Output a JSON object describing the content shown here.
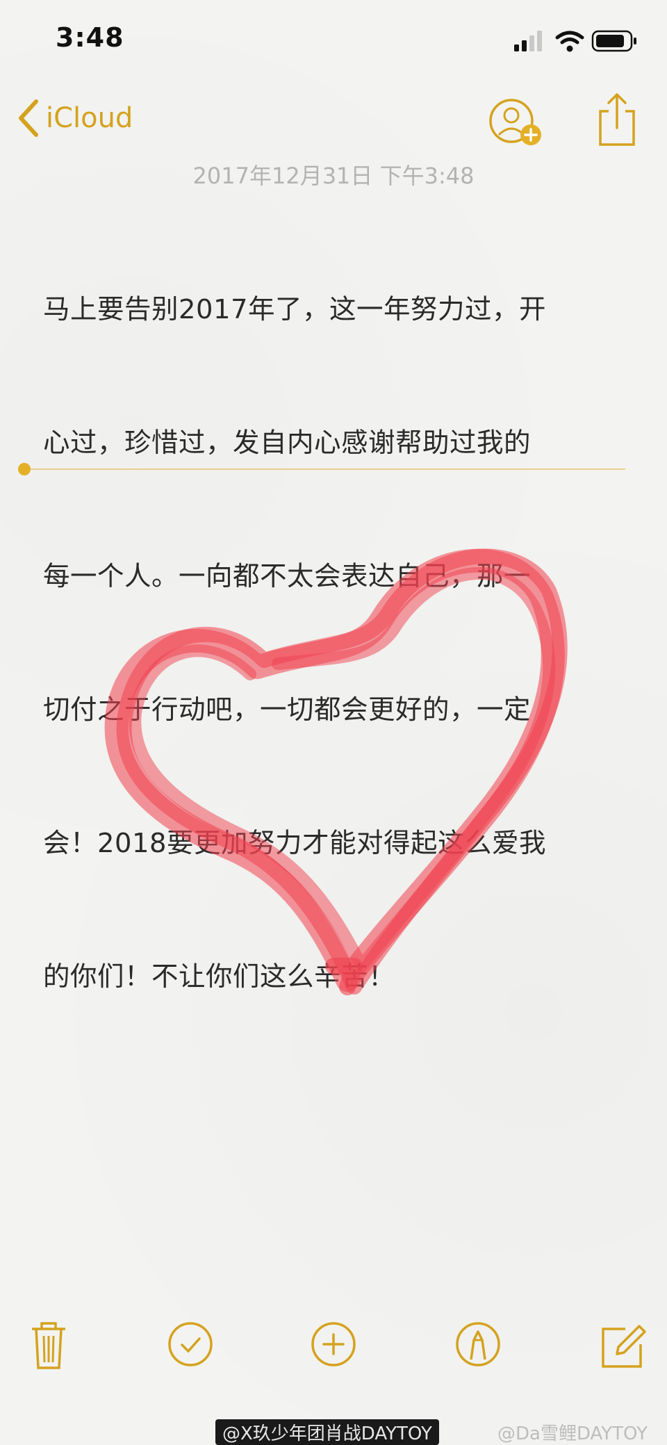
{
  "status": {
    "time": "3:48"
  },
  "nav": {
    "back_label": "iCloud"
  },
  "note": {
    "date": "2017年12月31日 下午3:48",
    "lines": [
      "马上要告别2017年了，这一年努力过，开",
      "心过，珍惜过，发自内心感谢帮助过我的",
      "每一个人。一向都不太会表达自己，那一",
      "切付之于行动吧，一切都会更好的，一定",
      "会！2018要更加努力才能对得起这么爱我",
      "的你们！不让你们这么辛苦！"
    ]
  },
  "toolbar": {
    "items": [
      "trash-icon",
      "checklist-icon",
      "add-icon",
      "markup-icon",
      "compose-icon"
    ]
  },
  "watermark": {
    "left": "@X玖少年团肖战DAYTOY",
    "right": "@Da雪鲤DAYTOY"
  },
  "colors": {
    "accent": "#d4a21e",
    "heart": "#f0424f",
    "text": "#2a2a2a",
    "date": "#b3b3b3"
  }
}
